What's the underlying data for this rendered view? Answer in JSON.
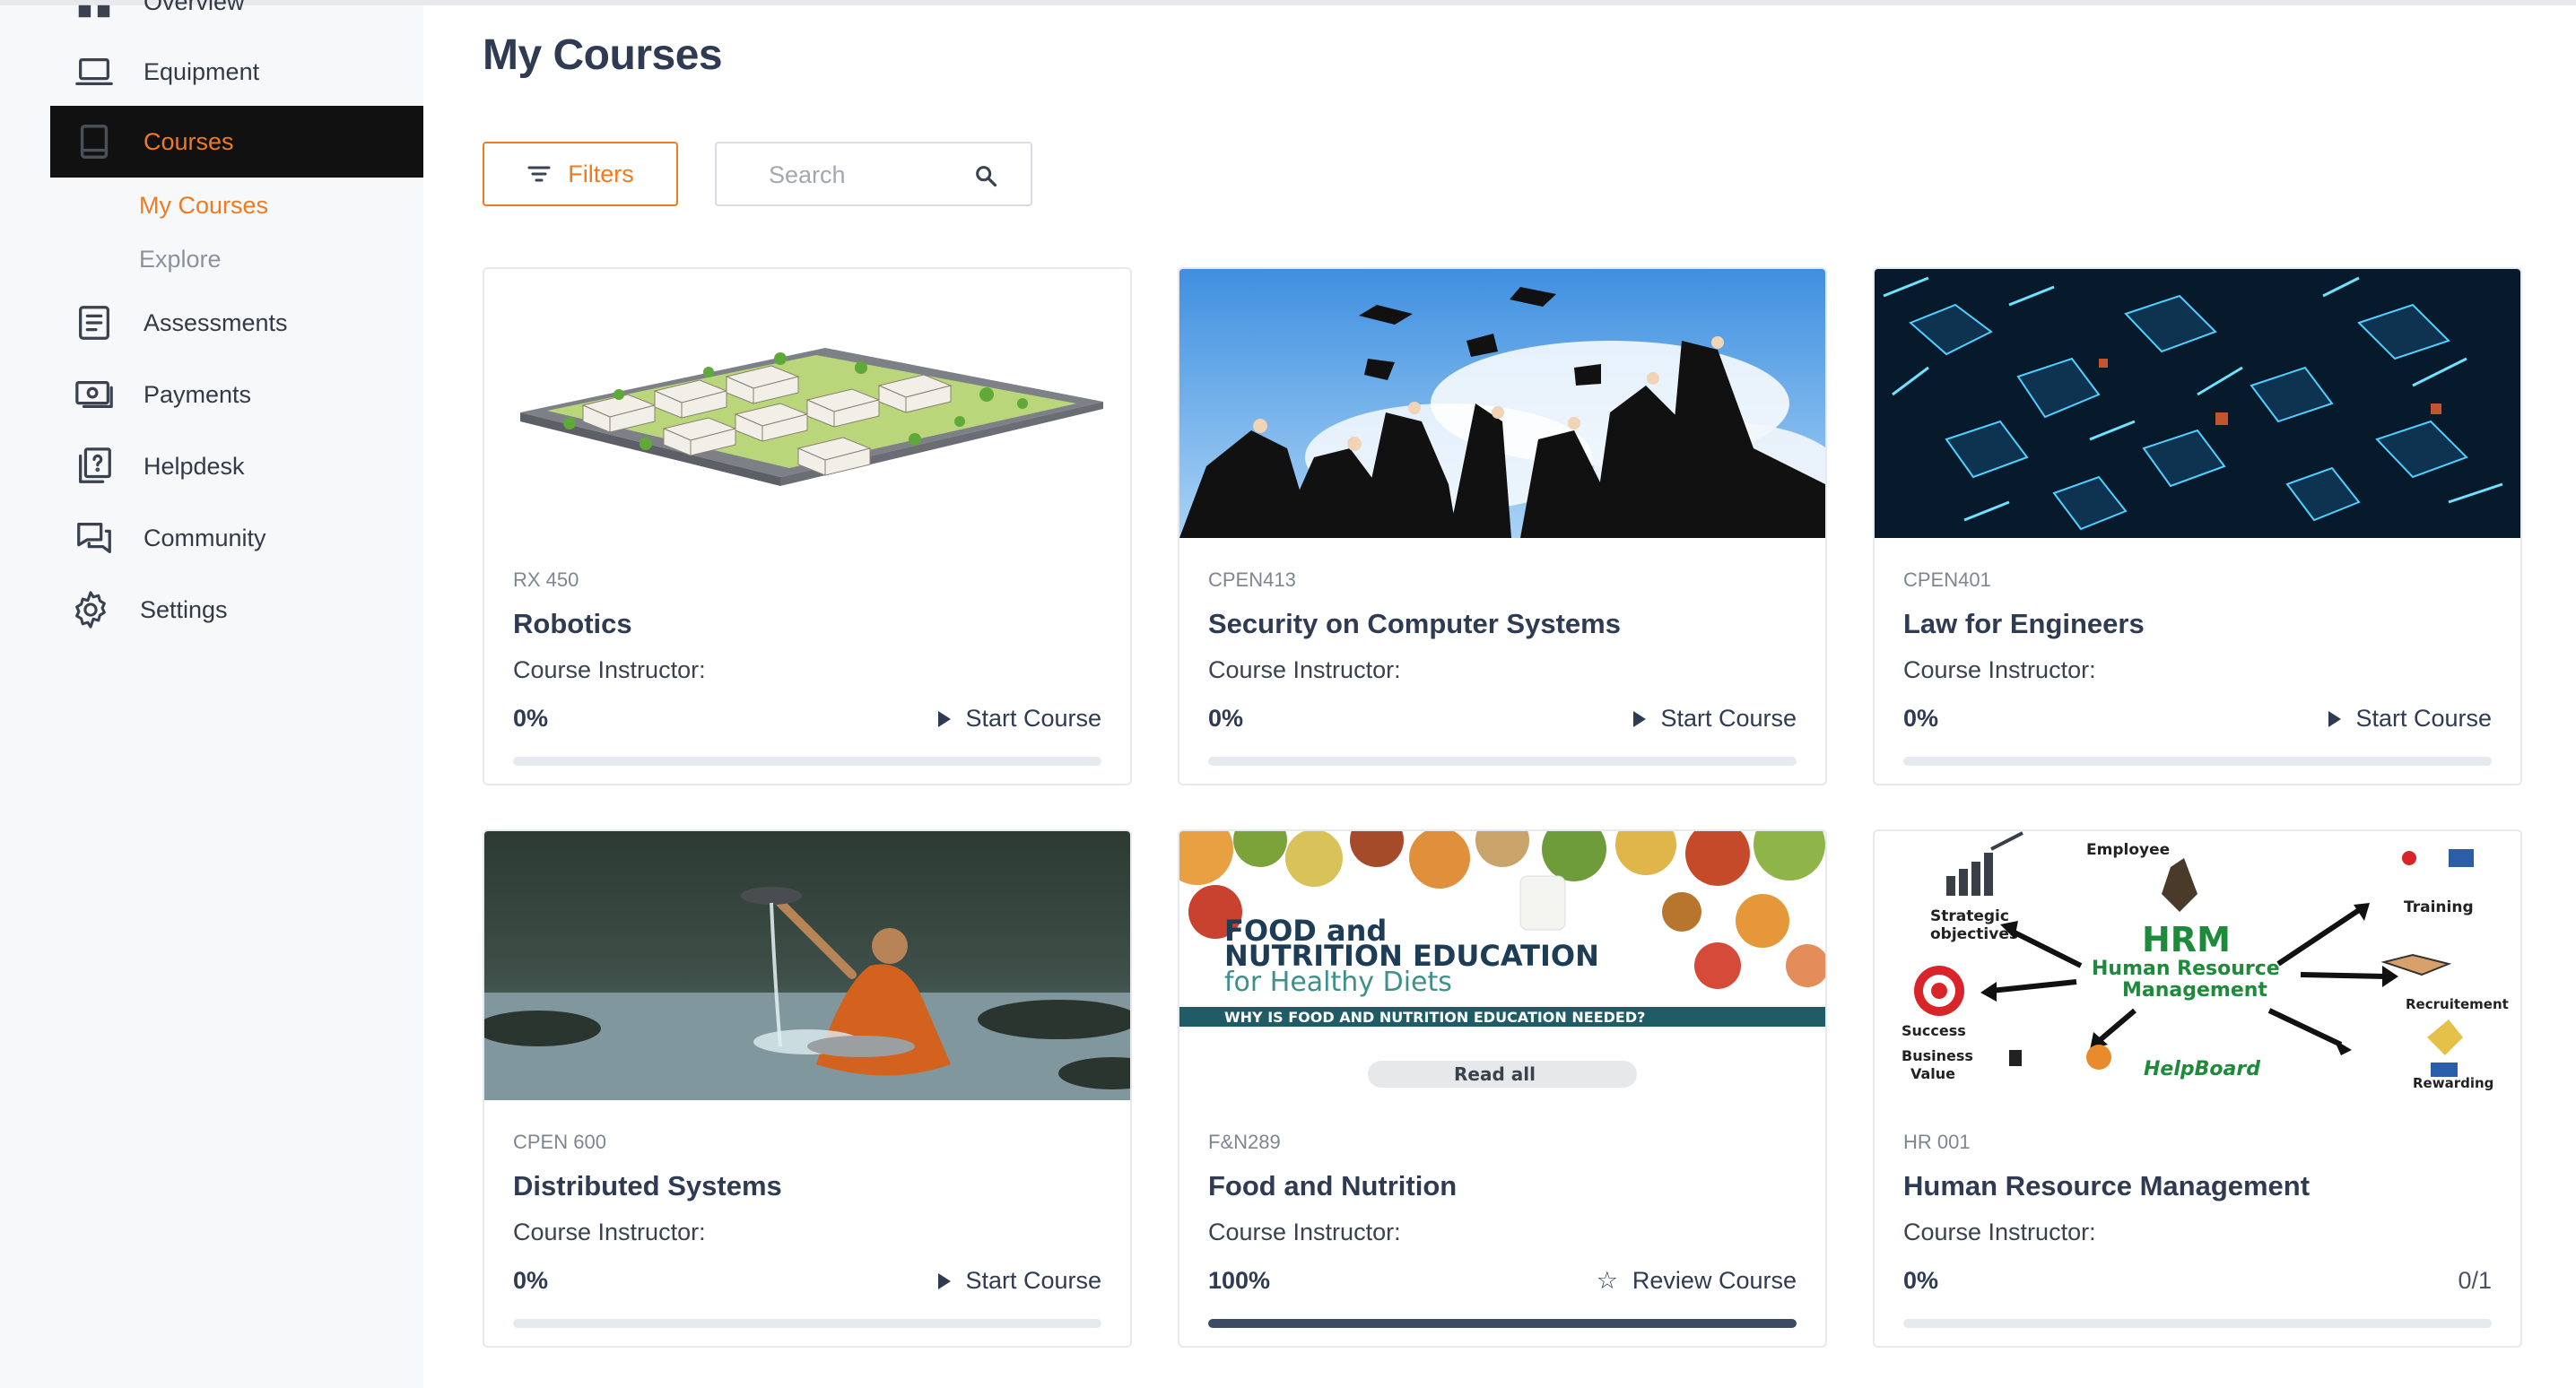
{
  "sidebar": {
    "items": [
      {
        "label": "Overview",
        "icon": "grid-icon"
      },
      {
        "label": "Equipment",
        "icon": "laptop-icon"
      },
      {
        "label": "Courses",
        "icon": "tablet-icon"
      },
      {
        "label": "Assessments",
        "icon": "document-icon"
      },
      {
        "label": "Payments",
        "icon": "money-icon"
      },
      {
        "label": "Helpdesk",
        "icon": "help-icon"
      },
      {
        "label": "Community",
        "icon": "chat-icon"
      },
      {
        "label": "Settings",
        "icon": "gear-icon"
      }
    ],
    "sub_items": [
      {
        "label": "My Courses"
      },
      {
        "label": "Explore"
      }
    ]
  },
  "main": {
    "title": "My Courses",
    "filters_label": "Filters",
    "search_placeholder": "Search"
  },
  "colors": {
    "accent": "#f07a1f",
    "active_nav_bg": "#111111",
    "heading": "#2f3b52",
    "progress_fill": "#3c4a63"
  },
  "courses": [
    {
      "code": "RX 450",
      "title": "Robotics",
      "instructor_label": "Course Instructor:",
      "progress": "0%",
      "action": "Start Course",
      "image": "isometric-houses"
    },
    {
      "code": "CPEN413",
      "title": "Security on Computer Systems",
      "instructor_label": "Course Instructor:",
      "progress": "0%",
      "action": "Start Course",
      "image": "graduation-caps"
    },
    {
      "code": "CPEN401",
      "title": "Law for Engineers",
      "instructor_label": "Course Instructor:",
      "progress": "0%",
      "action": "Start Course",
      "image": "blue-cubes"
    },
    {
      "code": "CPEN 600",
      "title": "Distributed Systems",
      "instructor_label": "Course Instructor:",
      "progress": "0%",
      "action": "Start Course",
      "image": "monk-in-river"
    },
    {
      "code": "F&N289",
      "title": "Food and Nutrition",
      "instructor_label": "Course Instructor:",
      "progress": "100%",
      "action": "Review Course",
      "image": "food-nutrition-banner",
      "image_text": {
        "line1": "FOOD and",
        "line2": "NUTRITION EDUCATION",
        "line3": "for Healthy Diets",
        "banner": "WHY IS FOOD AND NUTRITION EDUCATION NEEDED?",
        "button": "Read all"
      }
    },
    {
      "code": "HR 001",
      "title": "Human Resource Management",
      "instructor_label": "Course Instructor:",
      "progress": "0%",
      "count": "0/1",
      "image": "hrm-diagram",
      "image_text": {
        "center1": "HRM",
        "center2": "Human Resource",
        "center3": "Management",
        "employee": "Employee",
        "strategic1": "Strategic",
        "strategic2": "objectives",
        "training": "Training",
        "success": "Success",
        "recruitment": "Recruitement",
        "business1": "Business",
        "business2": "Value",
        "rewarding": "Rewarding",
        "brand": "HelpBoard"
      }
    }
  ]
}
